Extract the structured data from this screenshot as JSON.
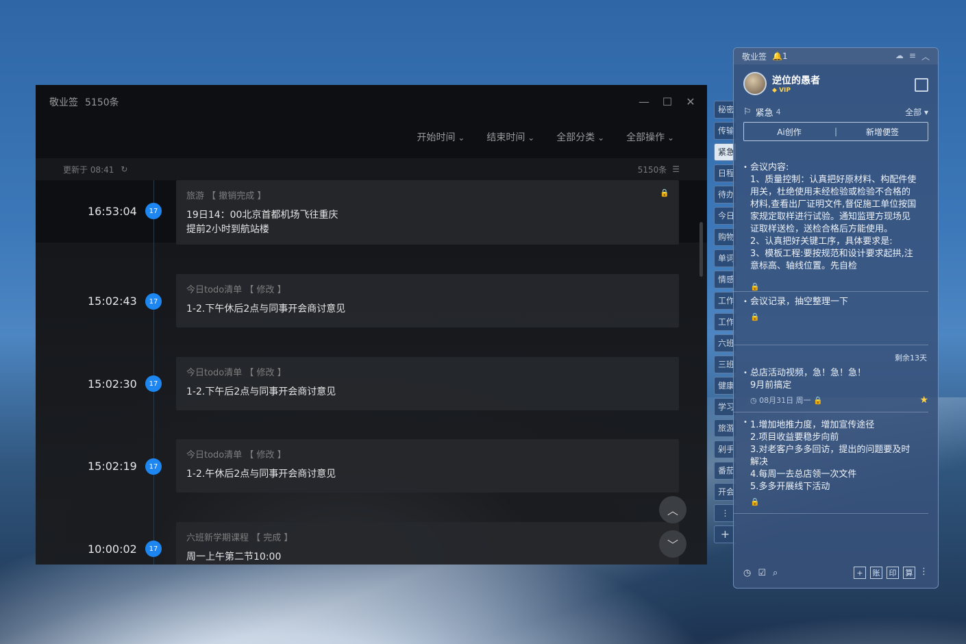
{
  "main_window": {
    "title": "敬业签",
    "count": "5150条",
    "filters": [
      "开始时间",
      "结束时间",
      "全部分类",
      "全部操作"
    ],
    "updated": "更新于 08:41",
    "total": "5150条",
    "entries": [
      {
        "time": "16:53:04",
        "day": "17",
        "category": "旅游",
        "action": "【 撤销完成 】",
        "line1": "19日14：00北京首都机场飞往重庆",
        "line2": "提前2小时到航站楼"
      },
      {
        "time": "15:02:43",
        "day": "17",
        "category": "今日todo清单",
        "action": "【 修改 】",
        "line1": "1-2.下午休后2点与同事开会商讨意见"
      },
      {
        "time": "15:02:30",
        "day": "17",
        "category": "今日todo清单",
        "action": "【 修改 】",
        "line1": "1-2.下午后2点与同事开会商讨意见"
      },
      {
        "time": "15:02:19",
        "day": "17",
        "category": "今日todo清单",
        "action": "【 修改 】",
        "line1": "1-2.午休后2点与同事开会商讨意见"
      },
      {
        "time": "10:00:02",
        "day": "17",
        "category": "六班新学期课程",
        "action": "【 完成 】",
        "line1": "周一上午第二节10:00"
      }
    ]
  },
  "side_tabs": [
    "秘密",
    "传输",
    "紧急",
    "日程",
    "待办",
    "今日",
    "购物",
    "单词",
    "情感",
    "工作",
    "工作",
    "六班",
    "三班",
    "健康",
    "学习",
    "旅游",
    "剁手",
    "番茄",
    "开会"
  ],
  "panel": {
    "app": "敬业签",
    "bell_count": "1",
    "username": "逆位的愚者",
    "vip": "VIP",
    "category": "紧急",
    "category_count": "4",
    "filter_all": "全部",
    "ai_button": "Ai创作",
    "new_button": "新增便签",
    "notes": [
      {
        "text": "会议内容:\n1、质量控制：认真把好原材料、构配件使用关，杜绝使用未经检验或检验不合格的材料,查看出厂证明文件,督促施工单位按国家规定取样进行试验。通知监理方现场见证取样送检，送检合格后方能使用。\n2、认真把好关键工序，具体要求是:\n3、模板工程:要按规范和设计要求起拱,注意标高、轴线位置。先自检"
      },
      {
        "text": "会议记录，抽空整理一下"
      },
      {
        "remain": "剩余13天",
        "text": "总店活动视频，急！急！急！\n9月前搞定",
        "date": "08月31日 周一"
      },
      {
        "text": "1.增加地推力度，增加宣传途径\n2.项目收益要稳步向前\n3.对老客户多多回访，提出的问题要及时解决\n4.每周一去总店领一次文件\n5.多多开展线下活动"
      }
    ],
    "bottom_tools": [
      "账",
      "印",
      "算"
    ]
  }
}
